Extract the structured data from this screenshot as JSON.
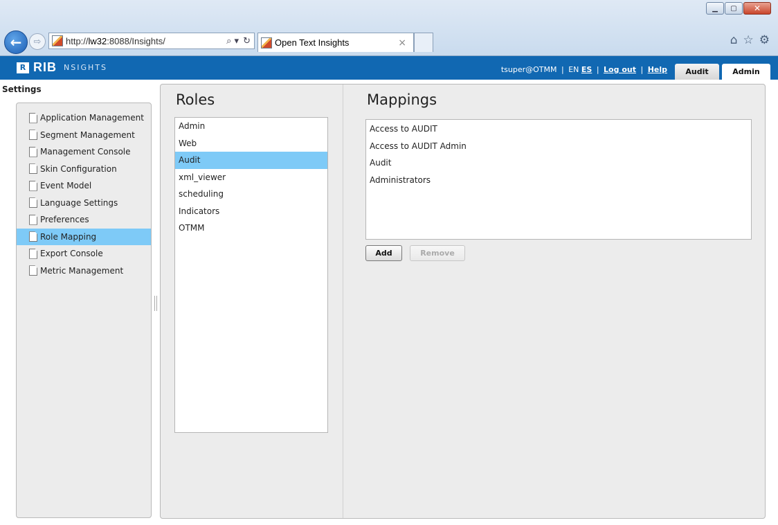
{
  "browser": {
    "url_prefix": "http://",
    "url_host": "lw32",
    "url_rest": ":8088/Insights/",
    "search_glyph": "⌕ ▾",
    "refresh_glyph": "↻",
    "tab_title": "Open Text Insights",
    "tab_close": "×",
    "back_glyph": "←",
    "forward_glyph": "⇨",
    "window_buttons": {
      "minimize": "▁",
      "maximize": "▢",
      "close": "✕"
    },
    "right_icons": {
      "home": "⌂",
      "favorites": "☆",
      "tools": "⚙"
    },
    "icons": [
      "back-icon",
      "forward-icon",
      "favicon",
      "search-icon",
      "refresh-icon",
      "home-icon",
      "star-icon",
      "gear-icon"
    ]
  },
  "header": {
    "logo_mark": "R",
    "logo_text": "RIB",
    "product": "NSIGHTS",
    "user": "tsuper@OTMM",
    "sep": "|",
    "lang_en": "EN",
    "lang_es": "ES",
    "logout": "Log out",
    "help": "Help",
    "tabs": {
      "audit": "Audit",
      "admin": "Admin"
    },
    "bg_color": "#1168b2"
  },
  "sidebar": {
    "title": "Settings",
    "items": [
      {
        "label": "Application Management"
      },
      {
        "label": "Segment Management"
      },
      {
        "label": "Management Console"
      },
      {
        "label": "Skin Configuration"
      },
      {
        "label": "Event Model"
      },
      {
        "label": "Language Settings"
      },
      {
        "label": "Preferences"
      },
      {
        "label": "Role Mapping"
      },
      {
        "label": "Export Console"
      },
      {
        "label": "Metric Management"
      }
    ],
    "selected_color": "#7ecaf7"
  },
  "roles": {
    "title": "Roles",
    "items": [
      "Admin",
      "Web",
      "Audit",
      "xml_viewer",
      "scheduling",
      "Indicators",
      "OTMM"
    ]
  },
  "mappings": {
    "title": "Mappings",
    "items": [
      "Access to AUDIT",
      "Access to AUDIT Admin",
      "Audit",
      "Administrators"
    ],
    "add_label": "Add",
    "remove_label": "Remove"
  }
}
